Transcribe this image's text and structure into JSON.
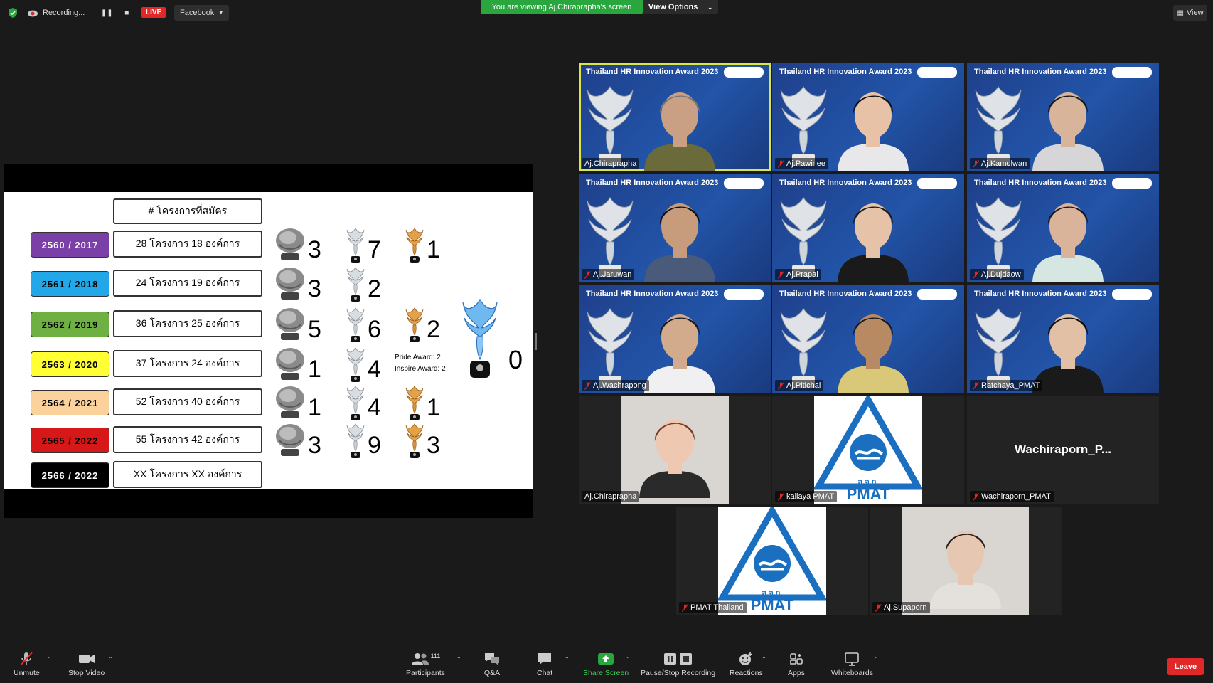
{
  "topbar": {
    "recording_label": "Recording...",
    "live_label": "LIVE",
    "stream_target": "Facebook",
    "viewing_banner": "You are viewing Aj.Chiraprapha's screen",
    "view_options": "View Options",
    "view_label": "View"
  },
  "slide": {
    "header": "# โครงการที่สมัคร",
    "rows": [
      {
        "year": "2560 / 2017",
        "color": "#7b3fa8",
        "text_color": "#ffffff",
        "projects": "28 โครงการ 18 องค์การ",
        "a1": "3",
        "a2": "7",
        "a3": "1"
      },
      {
        "year": "2561 / 2018",
        "color": "#22a8e8",
        "text_color": "#000000",
        "projects": "24 โครงการ 19 องค์การ",
        "a1": "3",
        "a2": "2",
        "a3": ""
      },
      {
        "year": "2562 / 2019",
        "color": "#6fb043",
        "text_color": "#000000",
        "projects": "36 โครงการ 25 องค์การ",
        "a1": "5",
        "a2": "6",
        "a3": "2"
      },
      {
        "year": "2563 / 2020",
        "color": "#ffff33",
        "text_color": "#000000",
        "projects": "37 โครงการ 24 องค์การ",
        "a1": "1",
        "a2": "4",
        "a3": ""
      },
      {
        "year": "2564 / 2021",
        "color": "#fbd29c",
        "text_color": "#000000",
        "projects": "52 โครงการ 40 องค์การ",
        "a1": "1",
        "a2": "4",
        "a3": "1"
      },
      {
        "year": "2565 / 2022",
        "color": "#d61818",
        "text_color": "#000000",
        "projects": "55 โครงการ 42 องค์การ",
        "a1": "3",
        "a2": "9",
        "a3": "3"
      },
      {
        "year": "2566 / 2022",
        "color": "#000000",
        "text_color": "#ffffff",
        "projects": "XX โครงการ XX องค์การ",
        "a1": "",
        "a2": "",
        "a3": ""
      }
    ],
    "pride_award": "Pride Award: 2",
    "inspire_award": "Inspire Award: 2",
    "big_trophy_count": "0"
  },
  "tiles": {
    "banner": "Thailand HR Innovation Award 2023",
    "names": [
      "Aj.Chiraprapha",
      "Aj.Pawinee",
      "Aj.Kamolwan",
      "Aj.Jaruwan",
      "Aj.Prapai",
      "Aj.Dujdaow",
      "Aj.Wachrapong",
      "Aj.Pitichai",
      "Ratchaya_PMAT",
      "Aj.Chiraprapha",
      "kallaya PMAT",
      "Wachiraporn_PMAT",
      "PMAT Thailand",
      "Aj.Supaporn"
    ],
    "wachiraporn_display": "Wachiraporn_P...",
    "pmat_text": "PMAT",
    "pmat_thai": "ส.จ.ก."
  },
  "toolbar": {
    "unmute": "Unmute",
    "stop_video": "Stop Video",
    "participants": "Participants",
    "participants_count": "111",
    "qa": "Q&A",
    "chat": "Chat",
    "share_screen": "Share Screen",
    "pause_recording": "Pause/Stop Recording",
    "reactions": "Reactions",
    "apps": "Apps",
    "whiteboards": "Whiteboards",
    "leave": "Leave"
  }
}
